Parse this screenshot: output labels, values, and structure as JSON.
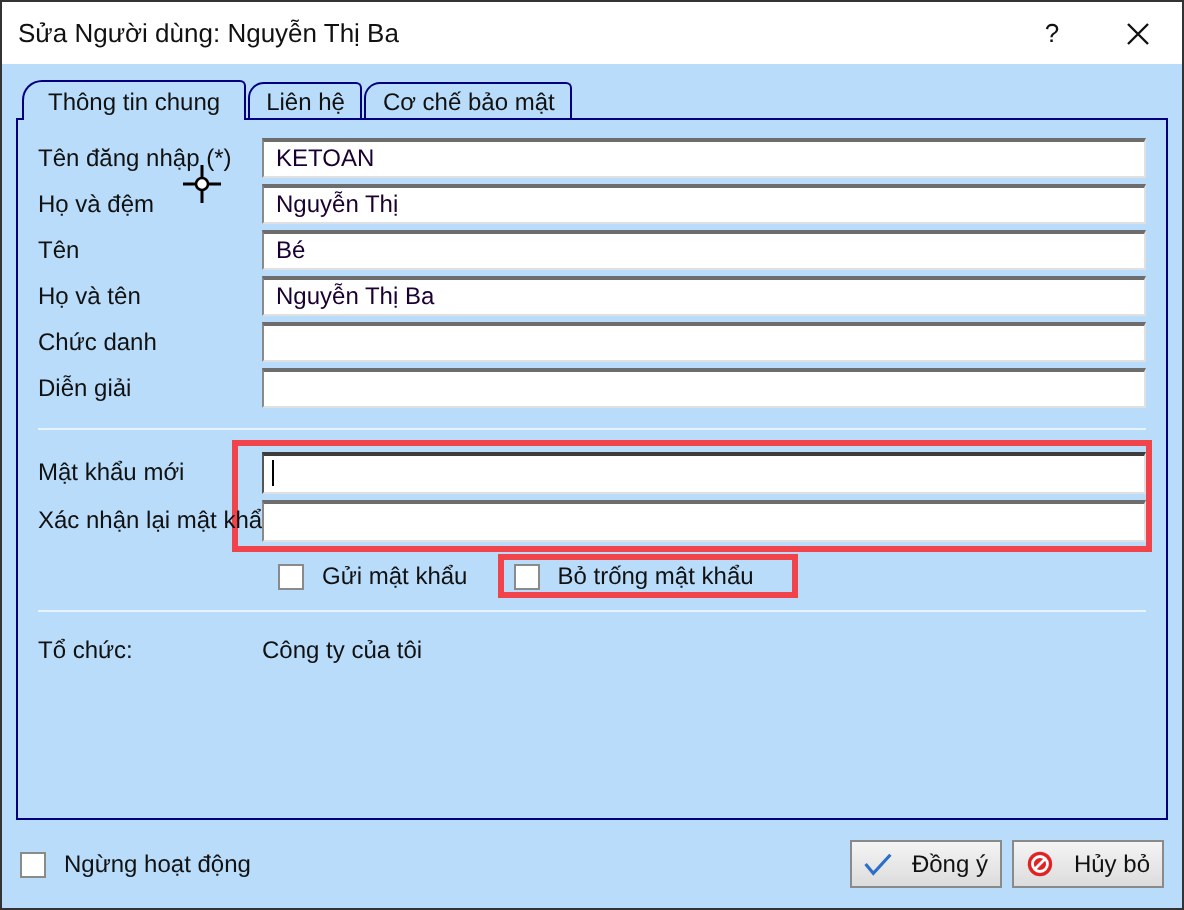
{
  "window": {
    "title": "Sửa Người dùng: Nguyễn Thị Ba",
    "help": "?"
  },
  "tabs": [
    {
      "label": "Thông tin chung",
      "selected": true
    },
    {
      "label": "Liên hệ",
      "selected": false
    },
    {
      "label": "Cơ chế bảo mật",
      "selected": false
    }
  ],
  "fields": [
    {
      "label": "Tên đăng nhập (*)",
      "value": "KETOAN"
    },
    {
      "label": "Họ và đệm",
      "value": "Nguyễn Thị"
    },
    {
      "label": "Tên",
      "value": "Bé"
    },
    {
      "label": "Họ và tên",
      "value": "Nguyễn Thị Ba"
    },
    {
      "label": "Chức danh"
    },
    {
      "label": "Diễn giải"
    }
  ],
  "password": {
    "highlighted": true,
    "fields": [
      {
        "label": "Mật khẩu mới",
        "focused": true
      },
      {
        "label": "Xác nhận lại mật khẩ",
        "focused": false
      }
    ]
  },
  "options": [
    {
      "label": "Gửi mật khẩu",
      "checked": false,
      "highlighted": false
    },
    {
      "label": "Bỏ trống mật khẩu",
      "checked": false,
      "highlighted": true
    }
  ],
  "organization": {
    "label": "Tổ chức:",
    "value": "Công ty của tôi"
  },
  "inactive": {
    "label": "Ngừng hoạt động",
    "checked": false
  },
  "buttons": [
    {
      "label": "Đồng ý",
      "kind": "ok"
    },
    {
      "label": "Hủy bỏ",
      "kind": "cancel"
    }
  ]
}
